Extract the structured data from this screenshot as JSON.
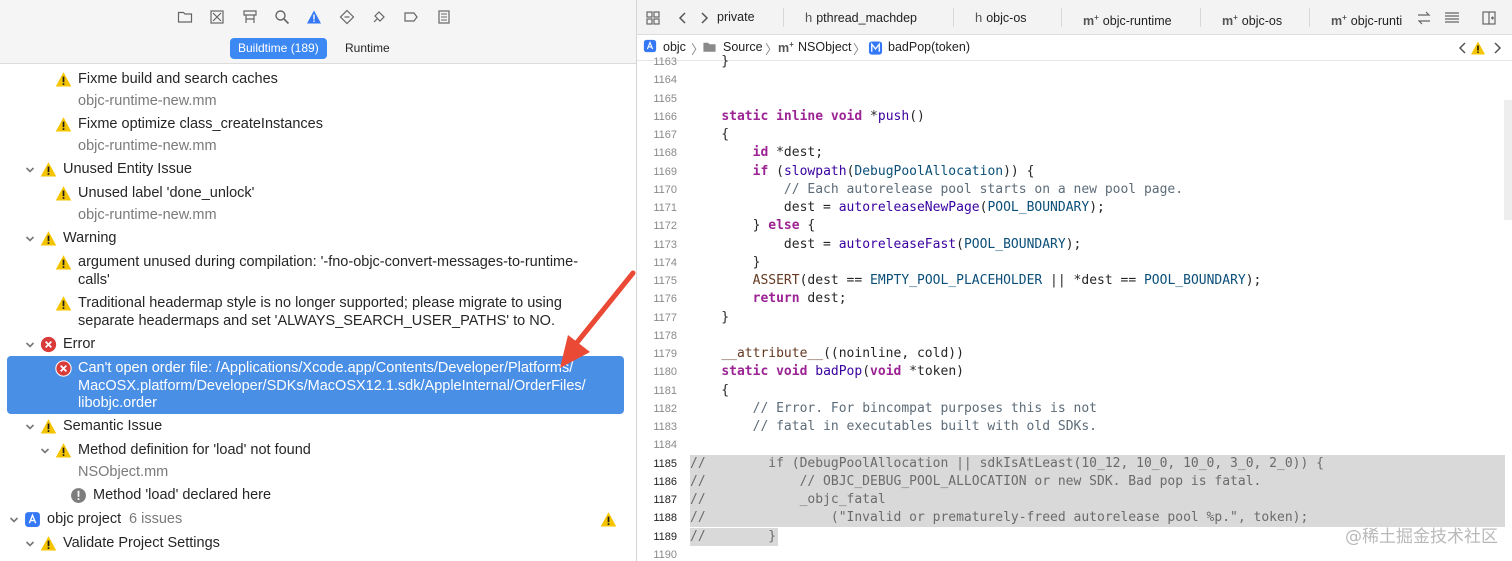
{
  "navigator": {
    "scope_buildtime": "Buildtime (189)",
    "scope_runtime": "Runtime",
    "issues": [
      {
        "level": 1,
        "icon": "warning",
        "text": "Fixme build and search caches",
        "sub": "objc-runtime-new.mm"
      },
      {
        "level": 1,
        "icon": "warning",
        "text": "Fixme optimize class_createInstances",
        "sub": "objc-runtime-new.mm"
      },
      {
        "level": 0,
        "icon": "warning",
        "text": "Unused Entity Issue"
      },
      {
        "level": 1,
        "icon": "warning",
        "text": "Unused label 'done_unlock'",
        "sub": "objc-runtime-new.mm"
      },
      {
        "level": 0,
        "icon": "warning",
        "text": "Warning"
      },
      {
        "level": 1,
        "icon": "warning",
        "text_lines": [
          "argument unused during compilation: '-fno-objc-convert-messages-to-runtime-",
          "calls'"
        ]
      },
      {
        "level": 1,
        "icon": "warning",
        "text_lines": [
          "Traditional headermap style is no longer supported; please migrate to using",
          "separate headermaps and set 'ALWAYS_SEARCH_USER_PATHS' to NO."
        ]
      },
      {
        "level": 0,
        "icon": "error",
        "text": "Error"
      },
      {
        "level": 1,
        "icon": "error",
        "selected": true,
        "text_lines": [
          "Can't open order file: /Applications/Xcode.app/Contents/Developer/Platforms/",
          "MacOSX.platform/Developer/SDKs/MacOSX12.1.sdk/AppleInternal/OrderFiles/",
          "libobjc.order"
        ]
      },
      {
        "level": 0,
        "icon": "warning",
        "text": "Semantic Issue"
      },
      {
        "level": 1,
        "icon": "warning",
        "text": "Method definition for 'load' not found",
        "sub": "NSObject.mm"
      },
      {
        "level": 2,
        "icon": "note",
        "text": "Method 'load' declared here"
      },
      {
        "level": -1,
        "icon": "project",
        "text": "objc project",
        "count": "6 issues"
      },
      {
        "level": 0,
        "icon": "warning",
        "text": "Validate Project Settings"
      }
    ]
  },
  "tabs": [
    {
      "icon": "",
      "label": "private"
    },
    {
      "icon": "h",
      "label": "pthread_machdep"
    },
    {
      "icon": "h",
      "label": "objc-os"
    },
    {
      "icon": "m",
      "label": "objc-runtime"
    },
    {
      "icon": "m",
      "label": "objc-os"
    },
    {
      "icon": "m",
      "label": "objc-runti"
    }
  ],
  "jump_bar": {
    "project": "objc",
    "folder": "Source",
    "file": "NSObject",
    "symbol": "badPop(token)"
  },
  "code": {
    "lines": [
      {
        "n": "1163",
        "t": "    }"
      },
      {
        "n": "1164",
        "t": ""
      },
      {
        "n": "1165",
        "t": ""
      },
      {
        "n": "1166",
        "t": "    static inline void *push()"
      },
      {
        "n": "1167",
        "t": "    {"
      },
      {
        "n": "1168",
        "t": "        id *dest;"
      },
      {
        "n": "1169",
        "t": "        if (slowpath(DebugPoolAllocation)) {"
      },
      {
        "n": "1170",
        "t": "            // Each autorelease pool starts on a new pool page."
      },
      {
        "n": "1171",
        "t": "            dest = autoreleaseNewPage(POOL_BOUNDARY);"
      },
      {
        "n": "1172",
        "t": "        } else {"
      },
      {
        "n": "1173",
        "t": "            dest = autoreleaseFast(POOL_BOUNDARY);"
      },
      {
        "n": "1174",
        "t": "        }"
      },
      {
        "n": "1175",
        "t": "        ASSERT(dest == EMPTY_POOL_PLACEHOLDER || *dest == POOL_BOUNDARY);"
      },
      {
        "n": "1176",
        "t": "        return dest;"
      },
      {
        "n": "1177",
        "t": "    }"
      },
      {
        "n": "1178",
        "t": ""
      },
      {
        "n": "1179",
        "t": "    __attribute__((noinline, cold))"
      },
      {
        "n": "1180",
        "t": "    static void badPop(void *token)"
      },
      {
        "n": "1181",
        "t": "    {"
      },
      {
        "n": "1182",
        "t": "        // Error. For bincompat purposes this is not"
      },
      {
        "n": "1183",
        "t": "        // fatal in executables built with old SDKs."
      },
      {
        "n": "1184",
        "t": ""
      },
      {
        "n": "1185",
        "t": "//        if (DebugPoolAllocation || sdkIsAtLeast(10_12, 10_0, 10_0, 3_0, 2_0)) {"
      },
      {
        "n": "1186",
        "t": "//            // OBJC_DEBUG_POOL_ALLOCATION or new SDK. Bad pop is fatal."
      },
      {
        "n": "1187",
        "t": "//            _objc_fatal"
      },
      {
        "n": "1188",
        "t": "//                (\"Invalid or prematurely-freed autorelease pool %p.\", token);"
      },
      {
        "n": "1189",
        "t": "//        }"
      },
      {
        "n": "1190",
        "t": ""
      }
    ]
  },
  "watermark": "@稀土掘金技术社区",
  "colors": {
    "selection": "#4a8fe6",
    "scope_active": "#3d89f3",
    "warning": "#f5c400",
    "error": "#d93b3b",
    "annotation_arrow": "#ea4a35"
  }
}
